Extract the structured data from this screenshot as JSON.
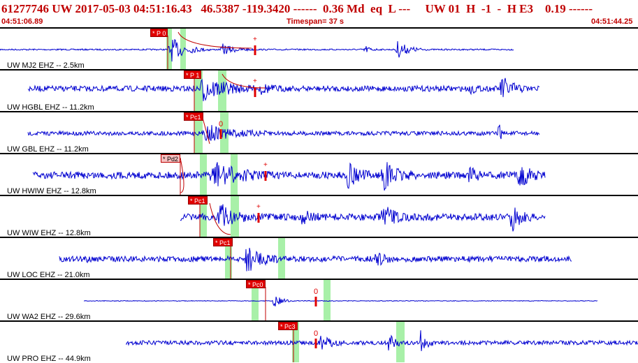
{
  "header": {
    "event_line": "61277746 UW 2017-05-03 04:51:16.43   46.5387 -119.3420 ------  0.36 Md  eq  L ---     UW 01  H  -1  -  H E3    0.19 ------",
    "start_time": "04:51:06.89",
    "timespan": "Timespan=  37 s",
    "end_time": "04:51:44.25"
  },
  "colors": {
    "trace": "#0000d0",
    "pick_red": "#e00000",
    "window_green": "#a8f0a8",
    "header_text": "#c00000"
  },
  "channels": [
    {
      "label": "UW MJ2 EHZ -- 2.5km",
      "pick": "* P 0"
    },
    {
      "label": "UW HGBL EHZ -- 11.2km",
      "pick": "* P 1"
    },
    {
      "label": "UW GBL EHZ -- 11.2km",
      "pick": "* Pc1",
      "marker": "0"
    },
    {
      "label": "UW HWIW EHZ -- 12.8km",
      "pick": "* Pd2"
    },
    {
      "label": "UW WIW EHZ -- 12.8km",
      "pick": "* Pc1"
    },
    {
      "label": "UW LOC EHZ -- 21.0km",
      "pick": "* Pc1"
    },
    {
      "label": "UW WA2 EHZ -- 29.6km",
      "pick": "* Pc0",
      "marker": "0"
    },
    {
      "label": "UW PRO EHZ -- 44.9km",
      "pick": "* Pc3",
      "marker": "0"
    }
  ]
}
